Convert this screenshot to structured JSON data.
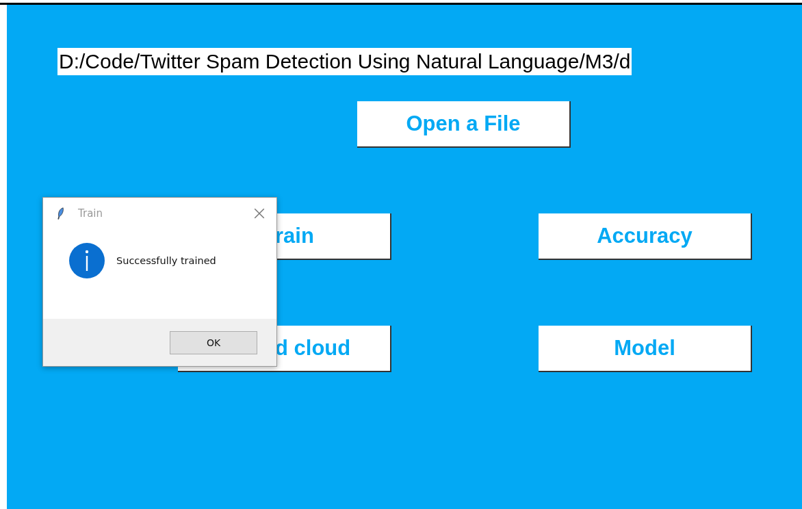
{
  "path_label": "D:/Code/Twitter Spam Detection Using Natural Language/M3/d",
  "open_file_button": "Open a File",
  "button_grid": [
    {
      "left": "rain",
      "right": "Accuracy"
    },
    {
      "left": "d cloud",
      "right": "Model"
    }
  ],
  "dialog": {
    "title": "Train",
    "message": "Successfully trained",
    "button": "OK"
  }
}
